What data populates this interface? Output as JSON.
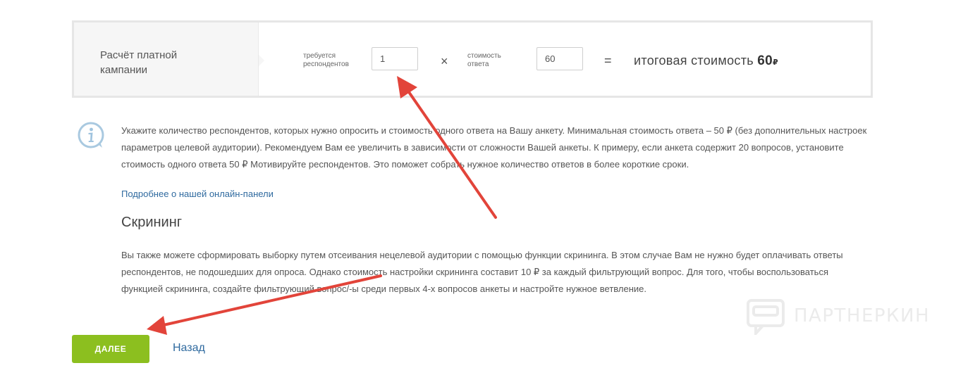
{
  "calc": {
    "label_line1": "Расчёт платной",
    "label_line2": "кампании",
    "respondents_label_line1": "требуется",
    "respondents_label_line2": "респондентов",
    "respondents_value": "1",
    "multiply_sign": "×",
    "cost_label_line1": "стоимость",
    "cost_label_line2": "ответа",
    "cost_value": "60",
    "equals_sign": "=",
    "total_label": "итоговая стоимость",
    "total_value": "60",
    "total_currency": "₽"
  },
  "info": {
    "icon": "info-icon",
    "text": "Укажите количество респондентов, которых нужно опросить и стоимость одного ответа на Вашу анкету. Минимальная стоимость ответа – 50 ₽ (без дополнительных настроек параметров целевой аудитории). Рекомендуем Вам ее увеличить в зависимости от сложности Вашей анкеты. К примеру, если анкета содержит 20 вопросов, установите стоимость одного ответа 50 ₽ Мотивируйте респондентов. Это поможет собрать нужное количество ответов в более короткие сроки.",
    "link_text": "Подробнее о нашей онлайн-панели"
  },
  "screening": {
    "title": "Скрининг",
    "text": "Вы также можете сформировать выборку путем отсеивания нецелевой аудитории с помощью функции скрининга. В этом случае Вам не нужно будет оплачивать ответы респондентов, не подошедших для опроса. Однако стоимость настройки скрининга составит 10 ₽ за каждый фильтрующий вопрос. Для того, чтобы воспользоваться функцией скрининга, создайте фильтрующий вопрос/-ы среди первых 4-х вопросов анкеты и настройте нужное ветвление."
  },
  "actions": {
    "next_label": "ДАЛЕЕ",
    "back_label": "Назад"
  },
  "watermark": {
    "text": "ПАРТНЕРКИН"
  },
  "colors": {
    "accent_green": "#8cbf1f",
    "link_blue": "#2f6a9f",
    "arrow_red": "#e2443a",
    "info_icon_blue": "#9fc3de"
  }
}
